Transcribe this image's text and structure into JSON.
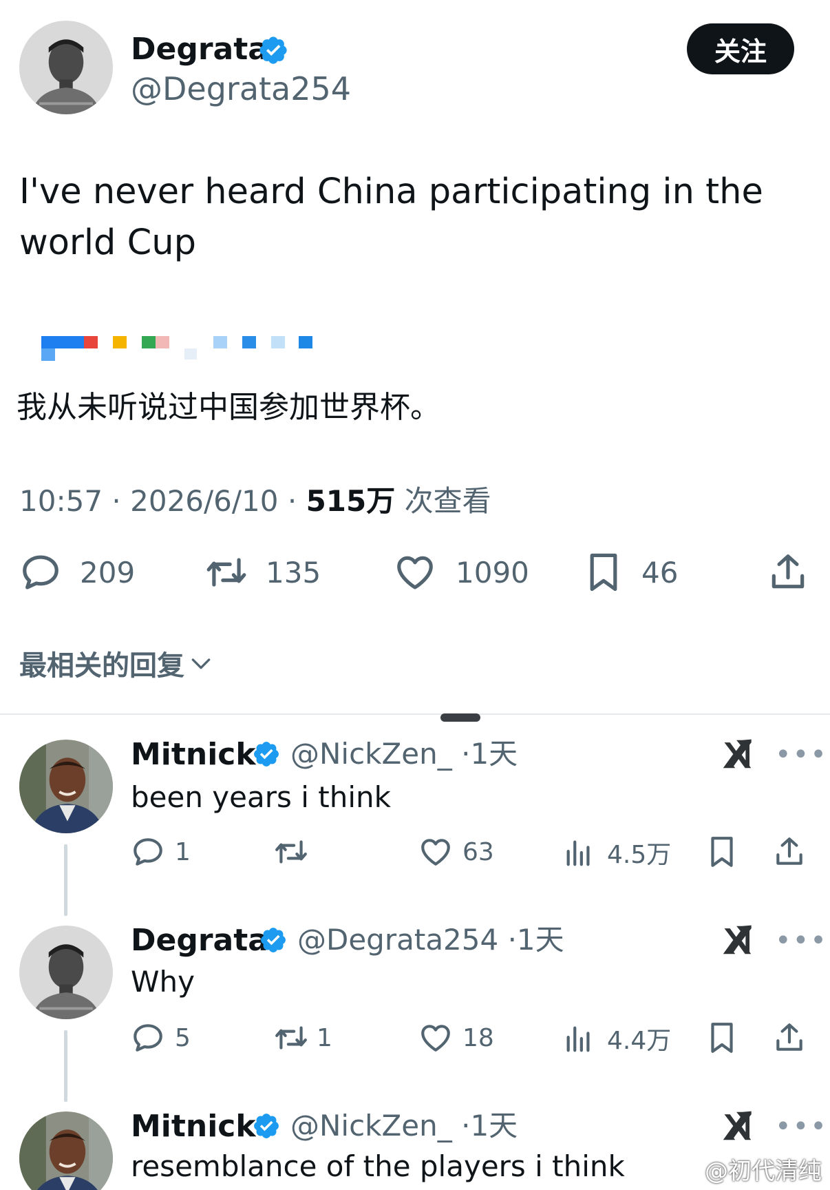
{
  "tweet": {
    "author": {
      "name": "Degrata",
      "handle": "@Degrata254"
    },
    "follow_label": "关注",
    "text": "I've never heard China participating in the world Cup",
    "translation": "我从未听说过中国参加世界杯。",
    "meta": {
      "time": "10:57",
      "date": "2026/6/10",
      "views": "515万",
      "views_label": "次查看",
      "sep": "·"
    },
    "stats": {
      "replies": "209",
      "retweets": "135",
      "likes": "1090",
      "bookmarks": "46"
    }
  },
  "replies_filter": {
    "label": "最相关的回复"
  },
  "replies": [
    {
      "name": "Mitnick",
      "handle": "@NickZen_",
      "age": "·1天",
      "text": "been years i think",
      "stats": {
        "replies": "1",
        "retweets": "",
        "likes": "63",
        "views": "4.5万"
      }
    },
    {
      "name": "Degrata",
      "handle": "@Degrata254",
      "age": "·1天",
      "text": "Why",
      "stats": {
        "replies": "5",
        "retweets": "1",
        "likes": "18",
        "views": "4.4万"
      }
    },
    {
      "name": "Mitnick",
      "handle": "@NickZen_",
      "age": "·1天",
      "text": "resemblance of the players i think"
    }
  ],
  "icons": {
    "verified": "verified-badge-icon",
    "reply": "reply-icon",
    "retweet": "retweet-icon",
    "like": "heart-icon",
    "bookmark": "bookmark-icon",
    "share": "share-icon",
    "views": "views-icon",
    "grok": "grok-icon",
    "more": "more-icon"
  },
  "colors": {
    "verified": "#1d9bf0",
    "text": "#0f1419",
    "muted": "#536471",
    "button": "#0f1419"
  },
  "watermark": "@初代清纯"
}
